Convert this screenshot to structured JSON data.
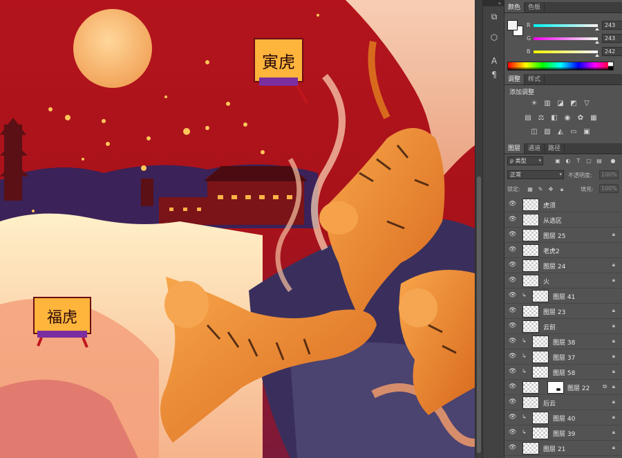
{
  "canvas": {
    "lantern_top_text": "寅虎",
    "lantern_left_text": "福虎"
  },
  "icon_strip": {
    "collapse_glyph": "«",
    "icons": [
      "layer-comps-icon",
      "3d-icon",
      "character-icon",
      "paragraph-icon"
    ]
  },
  "color_panel": {
    "tabs": [
      "颜色",
      "色板"
    ],
    "r": {
      "label": "R",
      "value": "243"
    },
    "g": {
      "label": "G",
      "value": "243"
    },
    "b": {
      "label": "B",
      "value": "242"
    },
    "foreground": "#f3f3f2"
  },
  "adjustments_panel": {
    "tabs": [
      "调整",
      "样式"
    ],
    "title": "添加调整"
  },
  "layers_panel": {
    "tabs": [
      "图层",
      "通道",
      "路径"
    ],
    "filter_kind": "ρ 类型",
    "blend_mode": "正常",
    "opacity_label": "不透明度:",
    "opacity_value": "100%",
    "lock_label": "锁定:",
    "fill_label": "填充:",
    "fill_value": "100%",
    "layers": [
      {
        "name": "虎须",
        "locked": false,
        "clipped": false
      },
      {
        "name": "从选区",
        "locked": false,
        "clipped": false
      },
      {
        "name": "图层 25",
        "locked": true,
        "clipped": false
      },
      {
        "name": "老虎2",
        "locked": false,
        "clipped": false
      },
      {
        "name": "图层 24",
        "locked": true,
        "clipped": false
      },
      {
        "name": "火",
        "locked": true,
        "clipped": false
      },
      {
        "name": "图层 41",
        "locked": false,
        "clipped": true
      },
      {
        "name": "图层 23",
        "locked": true,
        "clipped": false
      },
      {
        "name": "云前",
        "locked": true,
        "clipped": false
      },
      {
        "name": "图层 38",
        "locked": true,
        "clipped": true
      },
      {
        "name": "图层 37",
        "locked": true,
        "clipped": true
      },
      {
        "name": "图层 58",
        "locked": true,
        "clipped": true
      },
      {
        "name": "图层 22",
        "locked": true,
        "clipped": false,
        "mask": true
      },
      {
        "name": "后云",
        "locked": true,
        "clipped": false
      },
      {
        "name": "图层 40",
        "locked": true,
        "clipped": true
      },
      {
        "name": "图层 39",
        "locked": true,
        "clipped": true
      },
      {
        "name": "图层 21",
        "locked": true,
        "clipped": false
      }
    ]
  }
}
